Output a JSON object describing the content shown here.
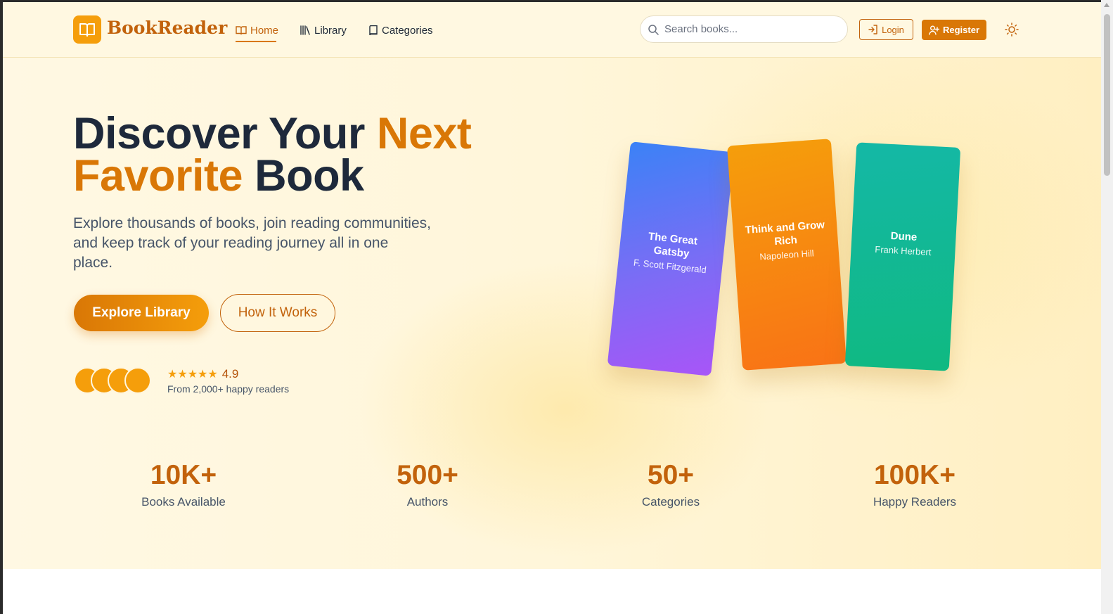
{
  "header": {
    "brand": "BookReader",
    "nav": [
      {
        "label": "Home",
        "icon": "open-book-icon",
        "active": true
      },
      {
        "label": "Library",
        "icon": "library-icon",
        "active": false
      },
      {
        "label": "Categories",
        "icon": "book-icon",
        "active": false
      }
    ],
    "search_placeholder": "Search books...",
    "login_label": "Login",
    "register_label": "Register"
  },
  "hero": {
    "headline_part1": "Discover Your ",
    "headline_accent1": "Next",
    "headline_accent2": "Favorite",
    "headline_part2": " Book",
    "subtext": "Explore thousands of books, join reading communities, and keep track of your reading journey all in one place.",
    "explore_label": "Explore Library",
    "how_label": "How It Works",
    "stars": "★★★★★",
    "rating": "4.9",
    "rating_caption": "From 2,000+ happy readers"
  },
  "books": [
    {
      "title": "The Great Gatsby",
      "author": "F. Scott Fitzgerald"
    },
    {
      "title": "Think and Grow Rich",
      "author": "Napoleon Hill"
    },
    {
      "title": "Dune",
      "author": "Frank Herbert"
    }
  ],
  "stats": [
    {
      "value": "10K+",
      "label": "Books Available"
    },
    {
      "value": "500+",
      "label": "Authors"
    },
    {
      "value": "50+",
      "label": "Categories"
    },
    {
      "value": "100K+",
      "label": "Happy Readers"
    }
  ],
  "colors": {
    "accent": "#d97706",
    "brand_text": "#c2620b",
    "heading": "#1e293b",
    "book_blue_purple": "#7c6cf5",
    "book_orange": "#f97316",
    "book_teal": "#14b8a6"
  }
}
